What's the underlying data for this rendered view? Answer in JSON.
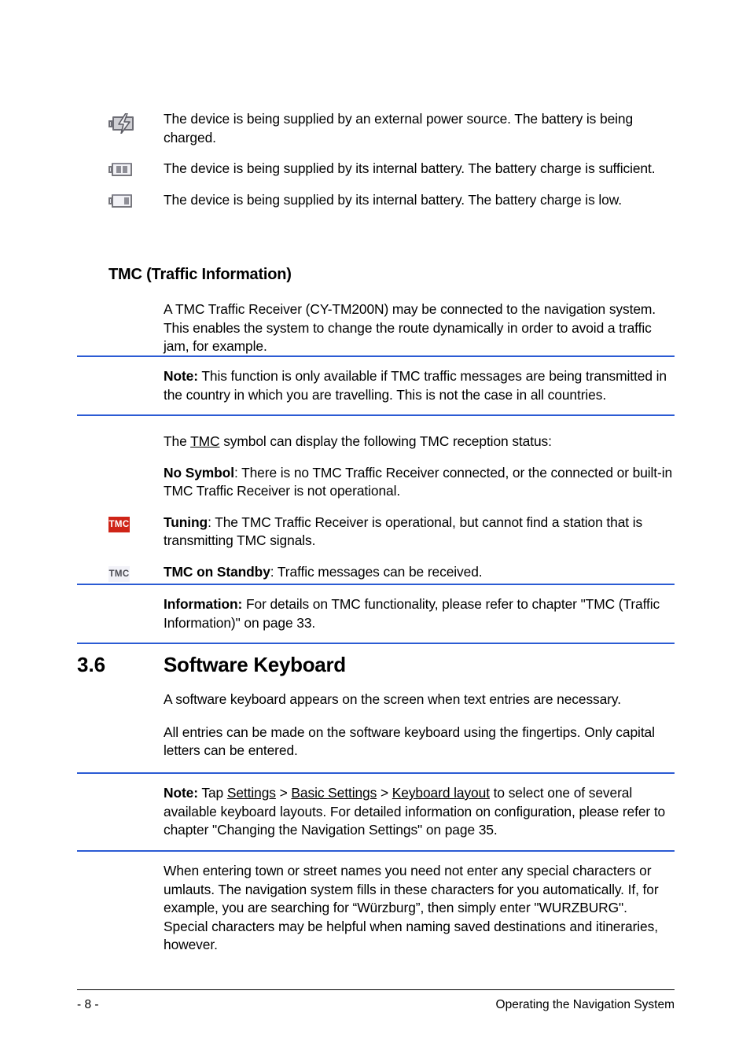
{
  "page": {
    "number_label": "- 8 -",
    "footer_title": "Operating the Navigation System",
    "accent_rule_color": "#2b5bd4",
    "tmc_tuning_color": "#cf2417",
    "tmc_standby_bg": "#f2f2f8"
  },
  "power_status": {
    "items": [
      {
        "icon": "battery-charging-icon",
        "text": "The device is being supplied by an external power source. The battery is being charged."
      },
      {
        "icon": "battery-sufficient-icon",
        "text": "The device is being supplied by its internal battery. The battery charge is sufficient."
      },
      {
        "icon": "battery-low-icon",
        "text": "The device is being supplied by its internal battery. The battery charge is low."
      }
    ]
  },
  "tmc_section": {
    "heading": "TMC (Traffic Information)",
    "intro": "A TMC Traffic Receiver (CY-TM200N) may be connected to the navigation system. This enables the system to change the route dynamically in order to avoid a traffic jam, for example.",
    "note": {
      "label": "Note:",
      "text": "This function is only available if TMC traffic messages are being transmitted in the country in which you are travelling. This is not the case in all countries."
    },
    "status_intro_pre": "The ",
    "status_intro_link": "TMC",
    "status_intro_post": " symbol can display the following TMC reception status:",
    "statuses": [
      {
        "icon": "none",
        "label": "No Symbol",
        "text": ": There is no TMC Traffic Receiver connected, or the connected or built-in TMC Traffic Receiver is not operational."
      },
      {
        "icon": "tmc-tuning-icon",
        "badge": "TMC",
        "label": "Tuning",
        "text": ": The TMC Traffic Receiver is operational, but cannot find a station that is transmitting TMC signals."
      },
      {
        "icon": "tmc-standby-icon",
        "badge": "TMC",
        "label": "TMC on Standby",
        "text": ": Traffic messages can be received."
      }
    ],
    "information": {
      "label": "Information:",
      "text": "For details on TMC functionality, please refer to chapter \"TMC (Traffic Information)\" on page 33."
    }
  },
  "software_keyboard_section": {
    "number": "3.6",
    "title": "Software Keyboard",
    "para1": "A software keyboard appears on the screen when text entries are necessary.",
    "para2": "All entries can be made on the software keyboard using the fingertips. Only capital letters can be entered.",
    "note": {
      "label": "Note:",
      "pre": "Tap ",
      "link1": "Settings",
      "sep1": " > ",
      "link2": "Basic Settings",
      "sep2": " > ",
      "link3": "Keyboard layout",
      "post": " to select one of several available keyboard layouts. For detailed information on configuration, please refer to chapter \"Changing the Navigation Settings\" on page 35."
    },
    "para3": "When entering town or street names you need not enter any special characters or umlauts. The navigation system fills in these characters for you automatically. If, for example, you are searching for “Würzburg”, then simply enter \"WURZBURG\". Special characters may be helpful when naming saved destinations and itineraries, however."
  }
}
